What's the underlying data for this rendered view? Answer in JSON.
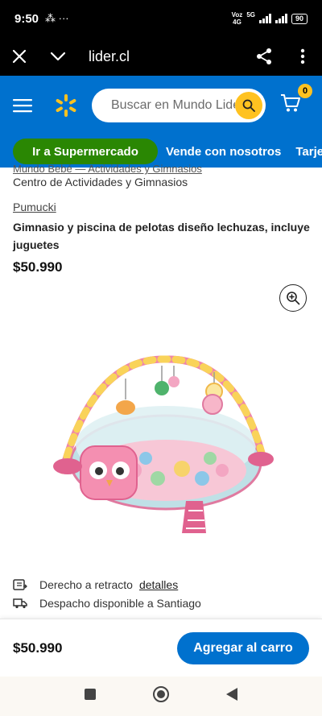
{
  "status_bar": {
    "time": "9:50",
    "extra": "⁂ ···",
    "network_top": "Voz",
    "network_bottom": "4G",
    "signal_label": "5G",
    "battery": "90"
  },
  "browser": {
    "url": "lider.cl"
  },
  "header": {
    "search_placeholder": "Buscar en Mundo Lider",
    "cart_count": "0",
    "accent_color": "#0071ce",
    "yellow": "#ffc220"
  },
  "nav": {
    "supermercado": "Ir a Supermercado",
    "vende": "Vende con nosotros",
    "tarjeta": "Tarjeta"
  },
  "product": {
    "breadcrumb_partial": "Mundo Bebé  —  Actividades y Gimnasios",
    "category": "Centro de Actividades y Gimnasios",
    "brand": "Pumucki",
    "title": "Gimnasio y piscina de pelotas diseño lechuzas, incluye juguetes",
    "price": "$50.990"
  },
  "info": {
    "retracto_label": "Derecho a retracto",
    "retracto_link": "detalles",
    "despacho": "Despacho disponible a Santiago"
  },
  "bottom_bar": {
    "price": "$50.990",
    "add_button": "Agregar al carro"
  }
}
